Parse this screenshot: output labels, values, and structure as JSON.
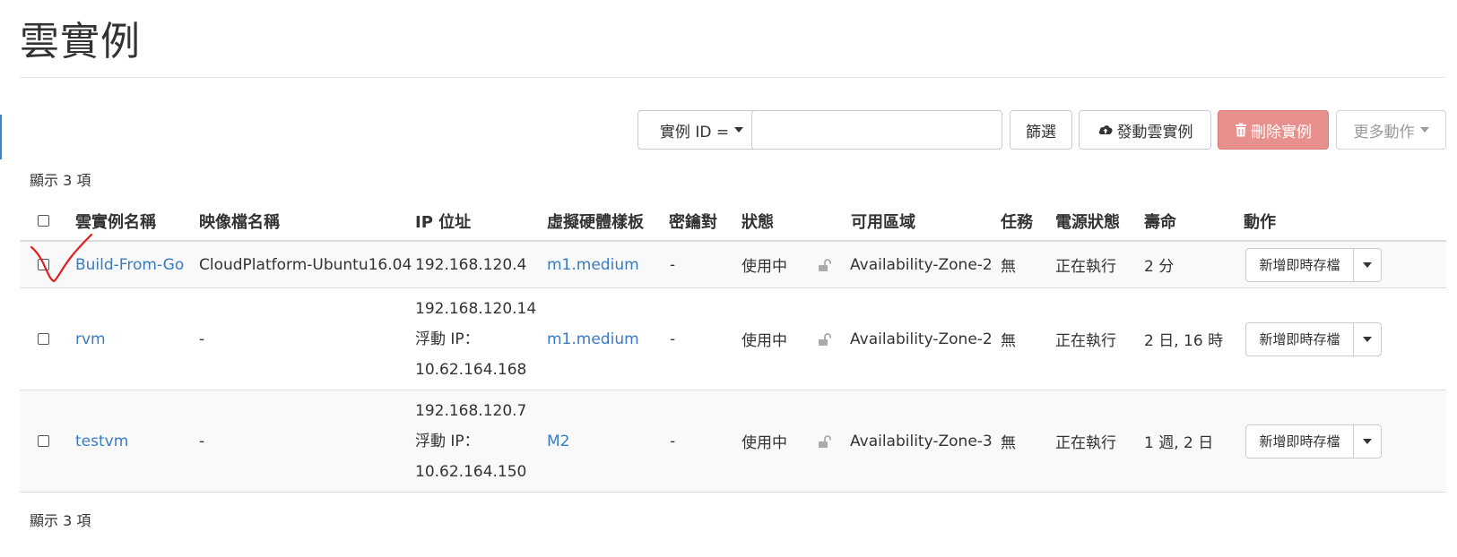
{
  "page": {
    "title": "雲實例"
  },
  "toolbar": {
    "filter_field": "實例 ID =",
    "filter_value": "",
    "filter_button": "篩選",
    "launch_button": "發動雲實例",
    "delete_button": "刪除實例",
    "more_button": "更多動作"
  },
  "count_text": "顯示 3 項",
  "table": {
    "headers": {
      "name": "雲實例名稱",
      "image": "映像檔名稱",
      "ip": "IP 位址",
      "flavor": "虛擬硬體樣板",
      "keypair": "密鑰對",
      "status": "狀態",
      "zone": "可用區域",
      "task": "任務",
      "power": "電源狀態",
      "age": "壽命",
      "actions": "動作"
    },
    "rows": [
      {
        "name": "Build-From-Go",
        "image": "CloudPlatform-Ubuntu16.04",
        "ip": [
          "192.168.120.4"
        ],
        "flavor": "m1.medium",
        "keypair": "-",
        "status": "使用中",
        "zone": "Availability-Zone-2",
        "task": "無",
        "power": "正在執行",
        "age": "2 分",
        "action": "新增即時存檔"
      },
      {
        "name": "rvm",
        "image": "-",
        "ip": [
          "192.168.120.14",
          "浮動 IP：",
          "10.62.164.168"
        ],
        "flavor": "m1.medium",
        "keypair": "-",
        "status": "使用中",
        "zone": "Availability-Zone-2",
        "task": "無",
        "power": "正在執行",
        "age": "2 日, 16 時",
        "action": "新增即時存檔"
      },
      {
        "name": "testvm",
        "image": "-",
        "ip": [
          "192.168.120.7",
          "浮動 IP：",
          "10.62.164.150"
        ],
        "flavor": "M2",
        "keypair": "-",
        "status": "使用中",
        "zone": "Availability-Zone-3",
        "task": "無",
        "power": "正在執行",
        "age": "1 週, 2 日",
        "action": "新增即時存檔"
      }
    ]
  },
  "colors": {
    "link": "#3a7bbf",
    "danger_button": "#e8908d",
    "annotation": "#e02020"
  },
  "icons": {
    "launch": "cloud-upload-icon",
    "delete": "trash-icon",
    "lock": "unlock-icon"
  }
}
